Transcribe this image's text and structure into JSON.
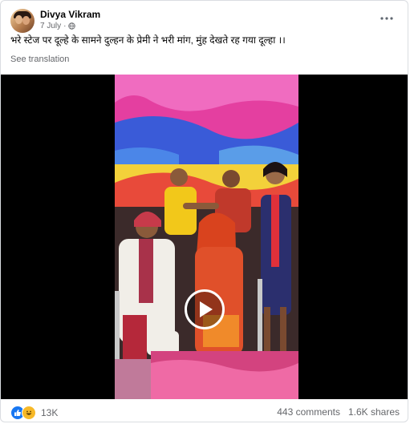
{
  "post": {
    "author": "Divya Vikram",
    "date": "7 July",
    "separator": "·",
    "text": "भरे स्टेज पर दूल्हे के सामने दुल्हन के प्रेमी ने भरी मांग, मुंह देखते रह गया दूल्हा ।।",
    "see_translation": "See translation",
    "more_icon": "more-dots-icon"
  },
  "footer": {
    "reaction_count": "13K",
    "comments": "443 comments",
    "shares": "1.6K shares",
    "reaction_icons": [
      "like-icon",
      "haha-icon"
    ]
  },
  "colors": {
    "accent": "#1877f2",
    "secondary_text": "#65676b",
    "haha": "#f7b928"
  }
}
